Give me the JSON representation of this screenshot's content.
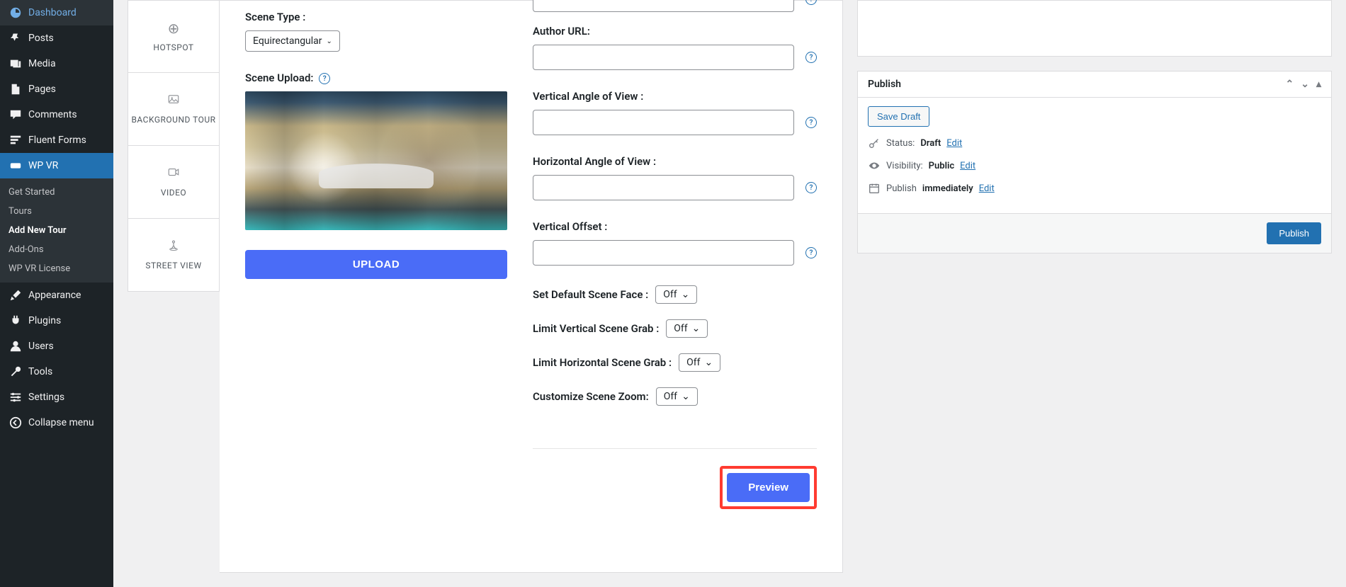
{
  "sidebar": {
    "items": [
      {
        "label": "Dashboard"
      },
      {
        "label": "Posts"
      },
      {
        "label": "Media"
      },
      {
        "label": "Pages"
      },
      {
        "label": "Comments"
      },
      {
        "label": "Fluent Forms"
      },
      {
        "label": "WP VR",
        "active": true
      },
      {
        "label": "Appearance"
      },
      {
        "label": "Plugins"
      },
      {
        "label": "Users"
      },
      {
        "label": "Tools"
      },
      {
        "label": "Settings"
      },
      {
        "label": "Collapse menu"
      }
    ],
    "submenu": [
      {
        "label": "Get Started"
      },
      {
        "label": "Tours"
      },
      {
        "label": "Add New Tour",
        "current": true
      },
      {
        "label": "Add-Ons"
      },
      {
        "label": "WP VR License"
      }
    ]
  },
  "tabs": {
    "hotspot": "HOTSPOT",
    "background": "BACKGROUND TOUR",
    "video": "VIDEO",
    "street": "STREET VIEW"
  },
  "left": {
    "scene_type_label": "Scene Type :",
    "scene_type_value": "Equirectangular",
    "scene_upload_label": "Scene Upload:",
    "upload_btn": "UPLOAD"
  },
  "right": {
    "author_url_label": "Author URL:",
    "vaov_label": "Vertical Angle of View :",
    "haov_label": "Horizontal Angle of View :",
    "voffset_label": "Vertical Offset :",
    "default_face_label": "Set Default Scene Face :",
    "default_face_value": "Off",
    "limit_vert_label": "Limit Vertical Scene Grab :",
    "limit_vert_value": "Off",
    "limit_horiz_label": "Limit Horizontal Scene Grab :",
    "limit_horiz_value": "Off",
    "zoom_label": "Customize Scene Zoom:",
    "zoom_value": "Off",
    "preview_btn": "Preview"
  },
  "publish": {
    "title": "Publish",
    "save_draft": "Save Draft",
    "status_label": "Status:",
    "status_value": "Draft",
    "visibility_label": "Visibility:",
    "visibility_value": "Public",
    "publish_label": "Publish",
    "publish_value": "immediately",
    "edit": "Edit",
    "publish_btn": "Publish"
  }
}
